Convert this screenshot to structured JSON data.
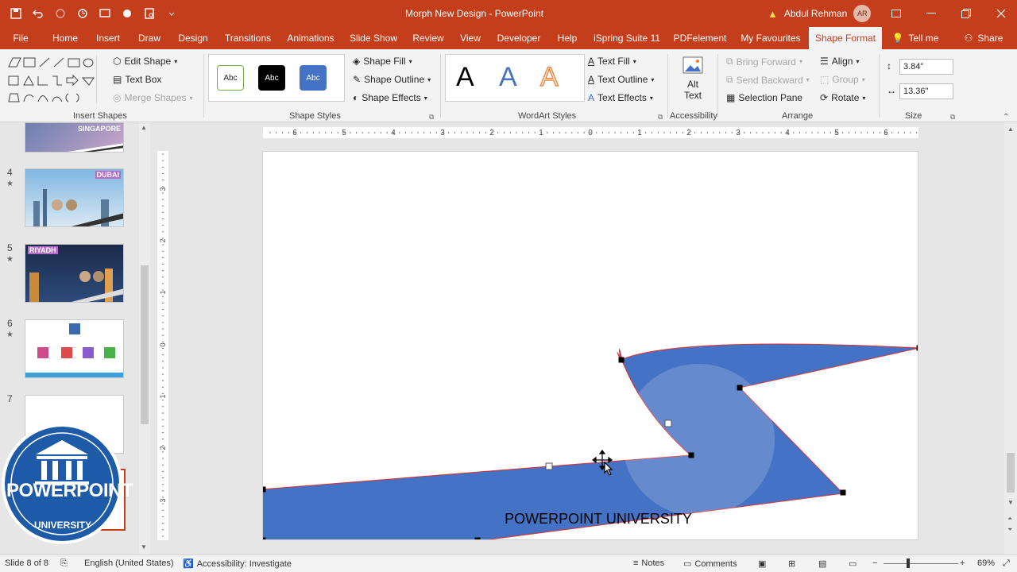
{
  "app": {
    "window_title": "Morph New Design  -  PowerPoint",
    "user_name": "Abdul Rehman",
    "user_initials": "AR",
    "accent_color": "#c43e1c"
  },
  "qat": [
    "save-icon",
    "undo-icon",
    "redo-icon",
    "format-painter-icon",
    "present-icon",
    "touch-mode-icon",
    "preview-icon",
    "customize-icon"
  ],
  "tabs": [
    {
      "label": "File"
    },
    {
      "label": "Home"
    },
    {
      "label": "Insert"
    },
    {
      "label": "Draw"
    },
    {
      "label": "Design"
    },
    {
      "label": "Transitions"
    },
    {
      "label": "Animations"
    },
    {
      "label": "Slide Show"
    },
    {
      "label": "Review"
    },
    {
      "label": "View"
    },
    {
      "label": "Developer"
    },
    {
      "label": "Help"
    },
    {
      "label": "iSpring Suite 11"
    },
    {
      "label": "PDFelement"
    },
    {
      "label": "My Favourites"
    },
    {
      "label": "Shape Format"
    },
    {
      "label": "Tell me"
    },
    {
      "label": "Share"
    }
  ],
  "ribbon": {
    "insert_shapes": {
      "label": "Insert Shapes",
      "edit_shape": "Edit Shape",
      "text_box": "Text Box",
      "merge_shapes": "Merge Shapes"
    },
    "shape_styles": {
      "label": "Shape Styles",
      "samples": [
        "Abc",
        "Abc",
        "Abc"
      ],
      "shape_fill": "Shape Fill",
      "shape_outline": "Shape Outline",
      "shape_effects": "Shape Effects"
    },
    "wordart": {
      "label": "WordArt Styles",
      "samples": [
        "A",
        "A",
        "A"
      ],
      "text_fill": "Text Fill",
      "text_outline": "Text Outline",
      "text_effects": "Text Effects"
    },
    "accessibility": {
      "label": "Accessibility",
      "alt_text_1": "Alt",
      "alt_text_2": "Text"
    },
    "arrange": {
      "label": "Arrange",
      "bring_forward": "Bring Forward",
      "send_backward": "Send Backward",
      "selection_pane": "Selection Pane",
      "align": "Align",
      "group": "Group",
      "rotate": "Rotate"
    },
    "size": {
      "label": "Size",
      "height": "3.84\"",
      "width": "13.36\""
    }
  },
  "slides_pane": {
    "slides": [
      {
        "num": "",
        "title": "SINGAPORE"
      },
      {
        "num": "4",
        "title": "DUBAI"
      },
      {
        "num": "5",
        "title": "RIYADH"
      },
      {
        "num": "6",
        "title": ""
      },
      {
        "num": "7",
        "title": ""
      }
    ]
  },
  "ruler": {
    "h_labels": [
      "6",
      "5",
      "4",
      "3",
      "2",
      "1",
      "0",
      "1",
      "2",
      "3",
      "4",
      "5",
      "6"
    ],
    "v_labels": [
      "3",
      "2",
      "1",
      "0",
      "1",
      "2",
      "3"
    ]
  },
  "slide": {
    "caption": "POWERPOINT UNIVERSITY",
    "shape_color": "#4472c4",
    "outline_color": "#e03030"
  },
  "logo": {
    "top_text": "POWERPOINT",
    "bottom_text": "UNIVERSITY"
  },
  "status": {
    "slide_counter": "Slide 8 of 8",
    "language": "English (United States)",
    "accessibility": "Accessibility: Investigate",
    "notes": "Notes",
    "comments": "Comments",
    "zoom": "69%"
  }
}
